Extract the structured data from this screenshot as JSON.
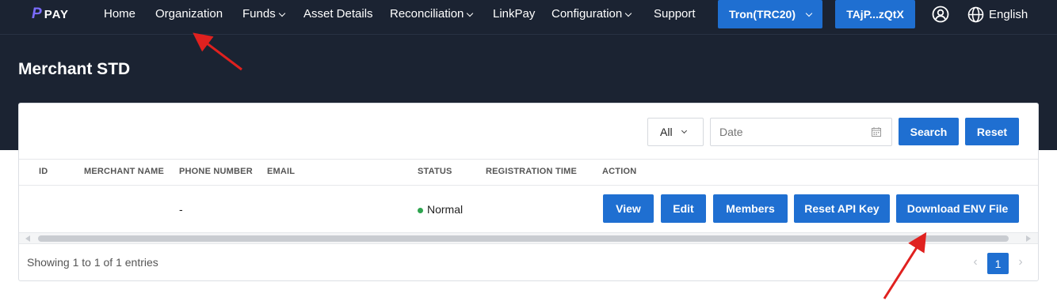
{
  "brand": {
    "mark": "P",
    "text": "PAY"
  },
  "nav": {
    "items": [
      {
        "label": "Home",
        "dropdown": false
      },
      {
        "label": "Organization",
        "dropdown": false
      },
      {
        "label": "Funds",
        "dropdown": true
      },
      {
        "label": "Asset Details",
        "dropdown": false
      },
      {
        "label": "Reconciliation",
        "dropdown": true
      },
      {
        "label": "LinkPay",
        "dropdown": false
      },
      {
        "label": "Configuration",
        "dropdown": true
      },
      {
        "label": "Support",
        "dropdown": false
      }
    ],
    "network_button": "Tron(TRC20)",
    "wallet_button": "TAjP...zQtX",
    "user_icon": "user-circle-icon",
    "language_icon": "globe-icon",
    "language": "English"
  },
  "page": {
    "title": "Merchant STD"
  },
  "filters": {
    "status_select": "All",
    "date_placeholder": "Date",
    "search_label": "Search",
    "reset_label": "Reset"
  },
  "table": {
    "columns": [
      "ID",
      "MERCHANT NAME",
      "PHONE NUMBER",
      "EMAIL",
      "STATUS",
      "REGISTRATION TIME",
      "ACTION"
    ],
    "rows": [
      {
        "id": "",
        "merchant_name": "",
        "phone": "-",
        "email": "",
        "status": "Normal",
        "registration_time": "",
        "actions": [
          "View",
          "Edit",
          "Members",
          "Reset API Key",
          "Download ENV File"
        ]
      }
    ]
  },
  "footer": {
    "showing": "Showing 1 to 1 of 1 entries",
    "prev": "‹",
    "current_page": "1",
    "next": "›"
  },
  "colors": {
    "primary": "#1f6fd1",
    "header_bg": "#1b2332",
    "status_normal": "#2ea44f",
    "annotation": "#e0211f"
  }
}
